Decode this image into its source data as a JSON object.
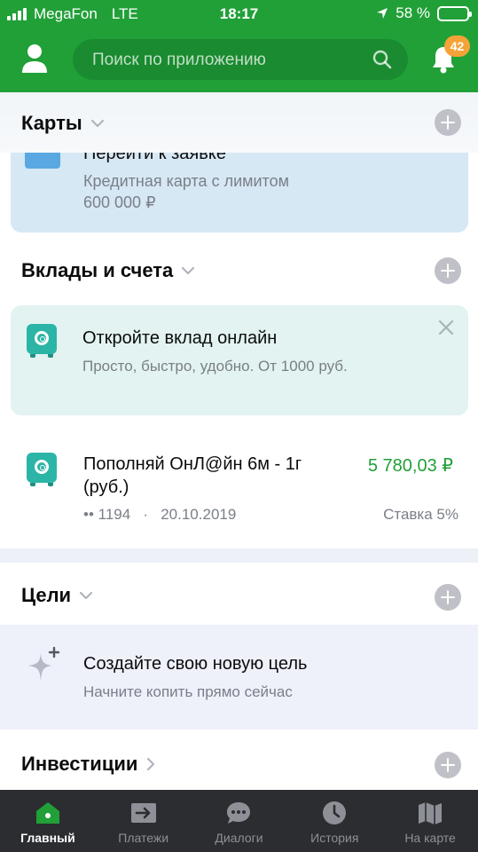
{
  "status_bar": {
    "carrier": "MegaFon",
    "network": "LTE",
    "time": "18:17",
    "battery": "58 %",
    "battery_level": 0.58
  },
  "header": {
    "search_placeholder": "Поиск по приложению",
    "notifications_count": "42"
  },
  "colors": {
    "brand_green": "#21a038",
    "badge_orange": "#f5a336",
    "teal": "#2bb5a6",
    "tabbar_bg": "#2b2d31"
  },
  "cards": {
    "title": "Карты",
    "credit_offer": {
      "title": "Перейти к заявке",
      "subtitle_line1": "Кредитная карта с лимитом",
      "subtitle_line2": "600 000 ₽"
    }
  },
  "deposits": {
    "title": "Вклады и счета",
    "promo": {
      "title": "Откройте вклад онлайн",
      "subtitle": "Просто, быстро, удобно. От 1000 руб."
    },
    "account": {
      "name_line1": "Пополняй ОнЛ@йн 6м - 1г",
      "name_line2": "(руб.)",
      "amount": "5 780,03 ₽",
      "number": "•• 1194",
      "date": "20.10.2019",
      "rate": "Ставка 5%"
    }
  },
  "goals": {
    "title": "Цели",
    "promo": {
      "title": "Создайте свою новую цель",
      "subtitle": "Начните копить прямо сейчас"
    }
  },
  "investments": {
    "title": "Инвестиции"
  },
  "tabbar": {
    "tabs": [
      {
        "label": "Главный",
        "icon": "home-icon",
        "active": true
      },
      {
        "label": "Платежи",
        "icon": "transfer-icon",
        "active": false
      },
      {
        "label": "Диалоги",
        "icon": "chat-icon",
        "active": false
      },
      {
        "label": "История",
        "icon": "clock-icon",
        "active": false
      },
      {
        "label": "На карте",
        "icon": "map-icon",
        "active": false
      }
    ]
  }
}
